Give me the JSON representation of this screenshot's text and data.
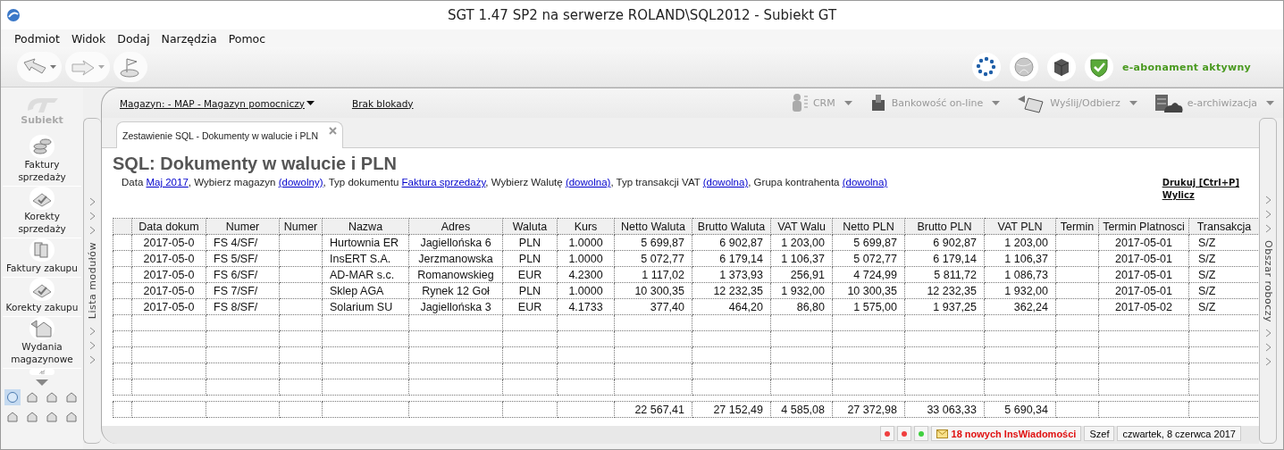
{
  "window": {
    "title": "SGT 1.47 SP2 na serwerze ROLAND\\SQL2012 - Subiekt GT"
  },
  "menu": [
    "Podmiot",
    "Widok",
    "Dodaj",
    "Narzędzia",
    "Pomoc"
  ],
  "subscription": "e-abonament aktywny",
  "sidebar": {
    "logo": "Subiekt",
    "items": [
      "Faktury sprzedaży",
      "Korekty sprzedaży",
      "Faktury zakupu",
      "Korekty zakupu",
      "Wydania magazynowe"
    ],
    "module_buttons": [
      {
        "selected": true
      },
      {
        "selected": false
      },
      {
        "selected": false
      },
      {
        "selected": false
      },
      {
        "selected": false
      },
      {
        "selected": false
      },
      {
        "selected": false
      },
      {
        "selected": false
      }
    ]
  },
  "modules_strip": "Lista modułów",
  "workspace_strip": "Obszar roboczy",
  "topbar": {
    "warehouse": "Magazyn: - MAP - Magazyn pomocniczy",
    "lock": "Brak blokady",
    "tools": [
      {
        "label": "CRM",
        "kind": "crm"
      },
      {
        "label": "Bankowość on-line",
        "kind": "bank"
      },
      {
        "label": "Wyślij/Odbierz",
        "kind": "send"
      },
      {
        "label": "e-archiwizacja",
        "kind": "archive"
      }
    ]
  },
  "tab": {
    "title": "Zestawienie SQL - Dokumenty w walucie i PLN"
  },
  "report": {
    "title": "SQL: Dokumenty w walucie i PLN",
    "filters": [
      {
        "kind": "text",
        "text": "Data "
      },
      {
        "kind": "link",
        "text": "Maj 2017"
      },
      {
        "kind": "text",
        "text": ", Wybierz magazyn "
      },
      {
        "kind": "link",
        "text": "(dowolny)"
      },
      {
        "kind": "text",
        "text": ", Typ dokumentu "
      },
      {
        "kind": "link",
        "text": "Faktura sprzedaży"
      },
      {
        "kind": "text",
        "text": ", Wybierz Walutę "
      },
      {
        "kind": "link",
        "text": "(dowolna)"
      },
      {
        "kind": "text",
        "text": ", Typ transakcji VAT "
      },
      {
        "kind": "link",
        "text": "(dowolna)"
      },
      {
        "kind": "text",
        "text": ", Grupa kontrahenta "
      },
      {
        "kind": "link",
        "text": "(dowolna)"
      }
    ],
    "actions": [
      "Drukuj [Ctrl+P]",
      "Wylicz"
    ]
  },
  "table": {
    "columns": [
      "Data dokum",
      "Numer",
      "Numer",
      "Nazwa",
      "Adres",
      "Waluta",
      "Kurs",
      "Netto Waluta",
      "Brutto Waluta",
      "VAT Walu",
      "Netto PLN",
      "Brutto PLN",
      "VAT PLN",
      "Termin",
      "Termin Platnosci",
      "Transakcja"
    ],
    "rows": [
      [
        "2017-05-0",
        "FS 4/SF/",
        "",
        "Hurtownia ER",
        "Jagiellońska  6",
        "PLN",
        "1.0000",
        "5 699,87",
        "6 902,87",
        "1 203,00",
        "5 699,87",
        "6 902,87",
        "1 203,00",
        "",
        "2017-05-01",
        "S/Z"
      ],
      [
        "2017-05-0",
        "FS 5/SF/",
        "",
        "InsERT S.A.",
        "Jerzmanowska",
        "PLN",
        "1.0000",
        "5 072,77",
        "6 179,14",
        "1 106,37",
        "5 072,77",
        "6 179,14",
        "1 106,37",
        "",
        "2017-05-01",
        "S/Z"
      ],
      [
        "2017-05-0",
        "FS 6/SF/",
        "",
        "AD-MAR s.c.",
        "Romanowskieg",
        "EUR",
        "4.2300",
        "1 117,02",
        "1 373,93",
        "256,91",
        "4 724,99",
        "5 811,72",
        "1 086,73",
        "",
        "2017-05-01",
        "S/Z"
      ],
      [
        "2017-05-0",
        "FS 7/SF/",
        "",
        "Sklep AGA",
        "Rynek 12  Goł",
        "PLN",
        "1.0000",
        "10 300,35",
        "12 232,35",
        "1 932,00",
        "10 300,35",
        "12 232,35",
        "1 932,00",
        "",
        "2017-05-01",
        "S/Z"
      ],
      [
        "2017-05-0",
        "FS 8/SF/",
        "",
        "Solarium SU",
        "Jagiellońska  3",
        "EUR",
        "4.1733",
        "377,40",
        "464,20",
        "86,80",
        "1 575,00",
        "1 937,25",
        "362,24",
        "",
        "2017-05-02",
        "S/Z"
      ]
    ],
    "totals": [
      "22 567,41",
      "27 152,49",
      "4 585,08",
      "27 372,98",
      "33 063,33",
      "5 690,34"
    ]
  },
  "status_bar": {
    "lights": [
      {
        "color": "#f04040"
      },
      {
        "color": "#f04040"
      },
      {
        "color": "#40d040"
      }
    ],
    "messages": "18 nowych InsWiadomości",
    "user": "Szef",
    "date": "czwartek, 8 czerwca 2017"
  }
}
